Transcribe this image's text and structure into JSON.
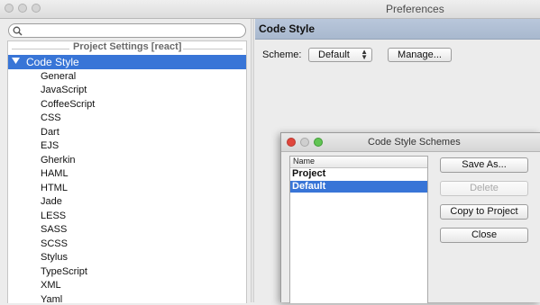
{
  "window": {
    "title": "Preferences"
  },
  "left": {
    "group_label": "Project Settings [react]",
    "selected": "Code Style",
    "items": [
      "General",
      "JavaScript",
      "CoffeeScript",
      "CSS",
      "Dart",
      "EJS",
      "Gherkin",
      "HAML",
      "HTML",
      "Jade",
      "LESS",
      "SASS",
      "SCSS",
      "Stylus",
      "TypeScript",
      "XML",
      "Yaml"
    ]
  },
  "main": {
    "header": "Code Style",
    "scheme_label": "Scheme:",
    "scheme_value": "Default",
    "manage_label": "Manage..."
  },
  "dialog": {
    "title": "Code Style Schemes",
    "column": "Name",
    "rows": [
      "Project",
      "Default"
    ],
    "selected_row": "Default",
    "buttons": {
      "save_as": "Save As...",
      "delete": "Delete",
      "copy": "Copy to Project",
      "close": "Close"
    }
  },
  "colors": {
    "selection": "#3875d7",
    "header": "#b3c2d8",
    "close_light": "#e0463c",
    "minimize_light": "#f0b536",
    "zoom_light": "#62c554"
  }
}
